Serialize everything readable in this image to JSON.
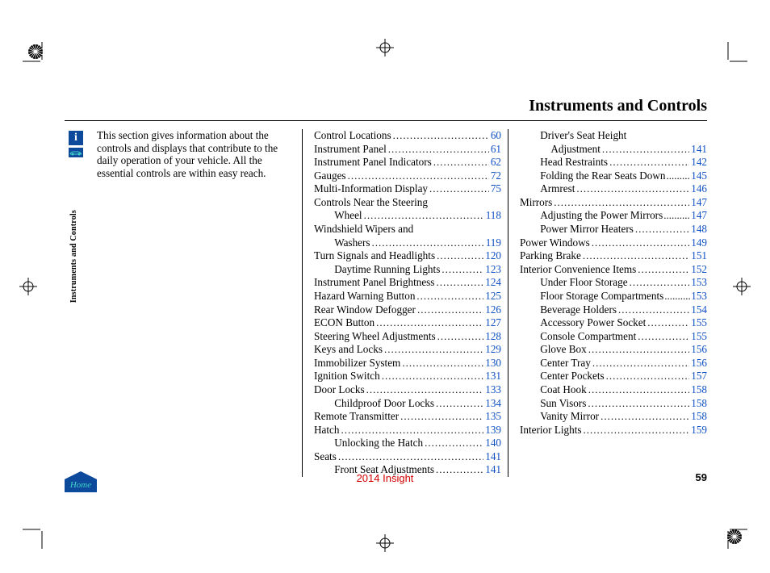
{
  "title": "Instruments and Controls",
  "intro": "This section gives information about the controls and displays that contribute to the daily operation of your vehicle. All the essential controls are within easy reach.",
  "side_label": "Instruments and Controls",
  "info_glyph": "i",
  "home_label": "Home",
  "footer_center": "2014 Insight",
  "page_number": "59",
  "toc_col1": [
    {
      "label": "Control Locations",
      "page": "60"
    },
    {
      "label": "Instrument Panel",
      "page": "61"
    },
    {
      "label": "Instrument Panel Indicators",
      "page": "62"
    },
    {
      "label": "Gauges",
      "page": "72"
    },
    {
      "label": "Multi-Information Display",
      "page": "75"
    },
    {
      "label": "Controls Near the Steering",
      "cont": true
    },
    {
      "label": "Wheel",
      "page": "118",
      "indent": true
    },
    {
      "label": "Windshield Wipers and",
      "cont": true
    },
    {
      "label": "Washers",
      "page": "119",
      "indent": true
    },
    {
      "label": "Turn Signals and Headlights",
      "page": "120"
    },
    {
      "label": "Daytime Running Lights",
      "page": "123",
      "indent": true
    },
    {
      "label": "Instrument Panel Brightness",
      "page": "124"
    },
    {
      "label": "Hazard Warning Button",
      "page": "125"
    },
    {
      "label": "Rear Window Defogger",
      "page": "126"
    },
    {
      "label": "ECON Button",
      "page": "127"
    },
    {
      "label": "Steering Wheel Adjustments",
      "page": "128"
    },
    {
      "label": "Keys and Locks",
      "page": "129"
    },
    {
      "label": "Immobilizer System",
      "page": "130"
    },
    {
      "label": "Ignition Switch",
      "page": "131"
    },
    {
      "label": "Door Locks",
      "page": "133"
    },
    {
      "label": "Childproof Door Locks",
      "page": "134",
      "indent": true
    },
    {
      "label": "Remote Transmitter",
      "page": "135"
    },
    {
      "label": "Hatch",
      "page": "139"
    },
    {
      "label": "Unlocking the Hatch",
      "page": "140",
      "indent": true
    },
    {
      "label": "Seats",
      "page": "141"
    },
    {
      "label": "Front Seat Adjustments",
      "page": "141",
      "indent": true
    }
  ],
  "toc_col2": [
    {
      "label": "Driver's Seat Height",
      "cont": true,
      "indent": true
    },
    {
      "label": "Adjustment",
      "page": "141",
      "indent": true,
      "double": true
    },
    {
      "label": "Head Restraints",
      "page": "142",
      "indent": true
    },
    {
      "label": "Folding the Rear Seats Down",
      "page": "145",
      "indent": true,
      "tight": true
    },
    {
      "label": "Armrest",
      "page": "146",
      "indent": true
    },
    {
      "label": "Mirrors",
      "page": "147"
    },
    {
      "label": "Adjusting the Power Mirrors",
      "page": "147",
      "indent": true,
      "tight": true
    },
    {
      "label": "Power Mirror Heaters",
      "page": "148",
      "indent": true
    },
    {
      "label": "Power Windows",
      "page": "149"
    },
    {
      "label": "Parking Brake",
      "page": "151"
    },
    {
      "label": "Interior Convenience Items",
      "page": "152"
    },
    {
      "label": "Under Floor Storage",
      "page": "153",
      "indent": true
    },
    {
      "label": "Floor Storage Compartments",
      "page": "153",
      "indent": true,
      "tight": true
    },
    {
      "label": "Beverage Holders",
      "page": "154",
      "indent": true
    },
    {
      "label": "Accessory Power Socket",
      "page": "155",
      "indent": true
    },
    {
      "label": "Console Compartment",
      "page": "155",
      "indent": true
    },
    {
      "label": "Glove Box",
      "page": "156",
      "indent": true
    },
    {
      "label": "Center Tray",
      "page": "156",
      "indent": true
    },
    {
      "label": "Center Pockets",
      "page": "157",
      "indent": true
    },
    {
      "label": "Coat Hook",
      "page": "158",
      "indent": true
    },
    {
      "label": "Sun Visors",
      "page": "158",
      "indent": true
    },
    {
      "label": "Vanity Mirror",
      "page": "158",
      "indent": true
    },
    {
      "label": "Interior Lights",
      "page": "159"
    }
  ]
}
